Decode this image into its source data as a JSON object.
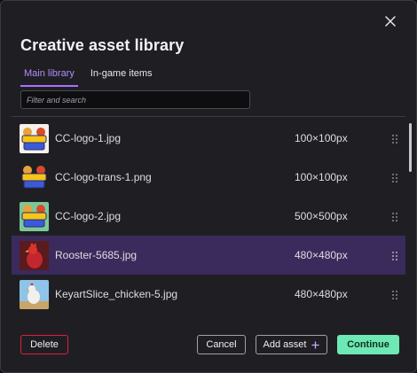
{
  "modal": {
    "title": "Creative asset library",
    "close_icon": "close-icon"
  },
  "tabs": [
    {
      "label": "Main library",
      "active": true
    },
    {
      "label": "In-game items",
      "active": false
    }
  ],
  "search": {
    "placeholder": "Filter and search",
    "value": ""
  },
  "assets": [
    {
      "name": "CC-logo-1.jpg",
      "size": "100×100px",
      "selected": false,
      "thumb": "chicken-chaos-logo"
    },
    {
      "name": "CC-logo-trans-1.png",
      "size": "100×100px",
      "selected": false,
      "thumb": "chicken-chaos-logo-transparent"
    },
    {
      "name": "CC-logo-2.jpg",
      "size": "500×500px",
      "selected": false,
      "thumb": "chicken-chaos-logo-green"
    },
    {
      "name": "Rooster-5685.jpg",
      "size": "480×480px",
      "selected": true,
      "thumb": "red-rooster"
    },
    {
      "name": "KeyartSlice_chicken-5.jpg",
      "size": "480×480px",
      "selected": false,
      "thumb": "chicken-keyart"
    }
  ],
  "footer": {
    "delete_label": "Delete",
    "cancel_label": "Cancel",
    "add_label": "Add asset",
    "add_icon": "plus-icon",
    "continue_label": "Continue"
  },
  "colors": {
    "accent_purple": "#a970ff",
    "selected_row": "#3b2a5c",
    "continue_green": "#6ee8b5",
    "delete_red": "#e01e3c"
  }
}
